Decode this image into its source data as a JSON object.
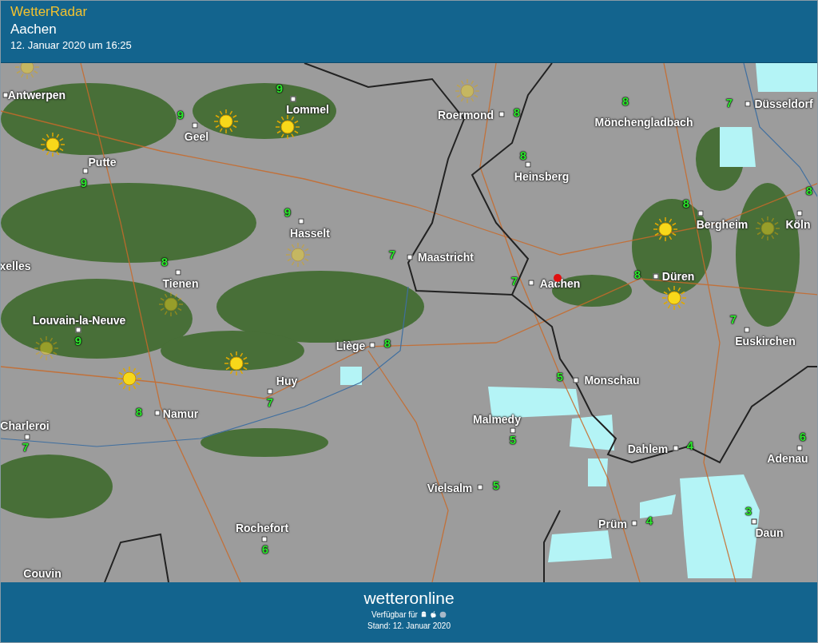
{
  "header": {
    "app_title": "WetterRadar",
    "location": "Aachen",
    "datetime": "12. Januar 2020 um 16:25"
  },
  "map": {
    "cities": [
      {
        "name": "Antwerpen"
      },
      {
        "name": "Lommel",
        "temp": "9"
      },
      {
        "name": "Geel",
        "temp": "9"
      },
      {
        "name": "Putte",
        "temp": "9"
      },
      {
        "name": "Roermond",
        "temp": "8"
      },
      {
        "name": "Mönchengladbach",
        "temp": "8"
      },
      {
        "name": "Düsseldorf",
        "temp": "7"
      },
      {
        "name": "Heinsberg",
        "temp": "8"
      },
      {
        "name": "Bergheim",
        "temp": "8"
      },
      {
        "name": "Köln",
        "temp": "8"
      },
      {
        "name": "Hasselt",
        "temp": "9"
      },
      {
        "name": "Maastricht",
        "temp": "7"
      },
      {
        "name": "xelles"
      },
      {
        "name": "Tienen",
        "temp": "8"
      },
      {
        "name": "Aachen",
        "temp": "7",
        "pinned": true
      },
      {
        "name": "Düren",
        "temp": "8"
      },
      {
        "name": "Louvain-la-Neuve",
        "temp": "9"
      },
      {
        "name": "Liège",
        "temp": "8"
      },
      {
        "name": "Euskirchen",
        "temp": "7"
      },
      {
        "name": "Huy",
        "temp": "7"
      },
      {
        "name": "Monschau",
        "temp": "5"
      },
      {
        "name": "Namur",
        "temp": "8"
      },
      {
        "name": "Charleroi",
        "temp": "7"
      },
      {
        "name": "Malmedy",
        "temp": "5"
      },
      {
        "name": "Dahlem",
        "temp": "4"
      },
      {
        "name": "Adenau",
        "temp": "6"
      },
      {
        "name": "Vielsalm",
        "temp": "5"
      },
      {
        "name": "Prüm",
        "temp": "4"
      },
      {
        "name": "Daun",
        "temp": "3"
      },
      {
        "name": "Rochefort",
        "temp": "6"
      },
      {
        "name": "Couvin"
      }
    ]
  },
  "footer": {
    "logo": "wetteronline",
    "available": "Verfügbar für",
    "stand": "Stand: 12. Januar 2020"
  }
}
